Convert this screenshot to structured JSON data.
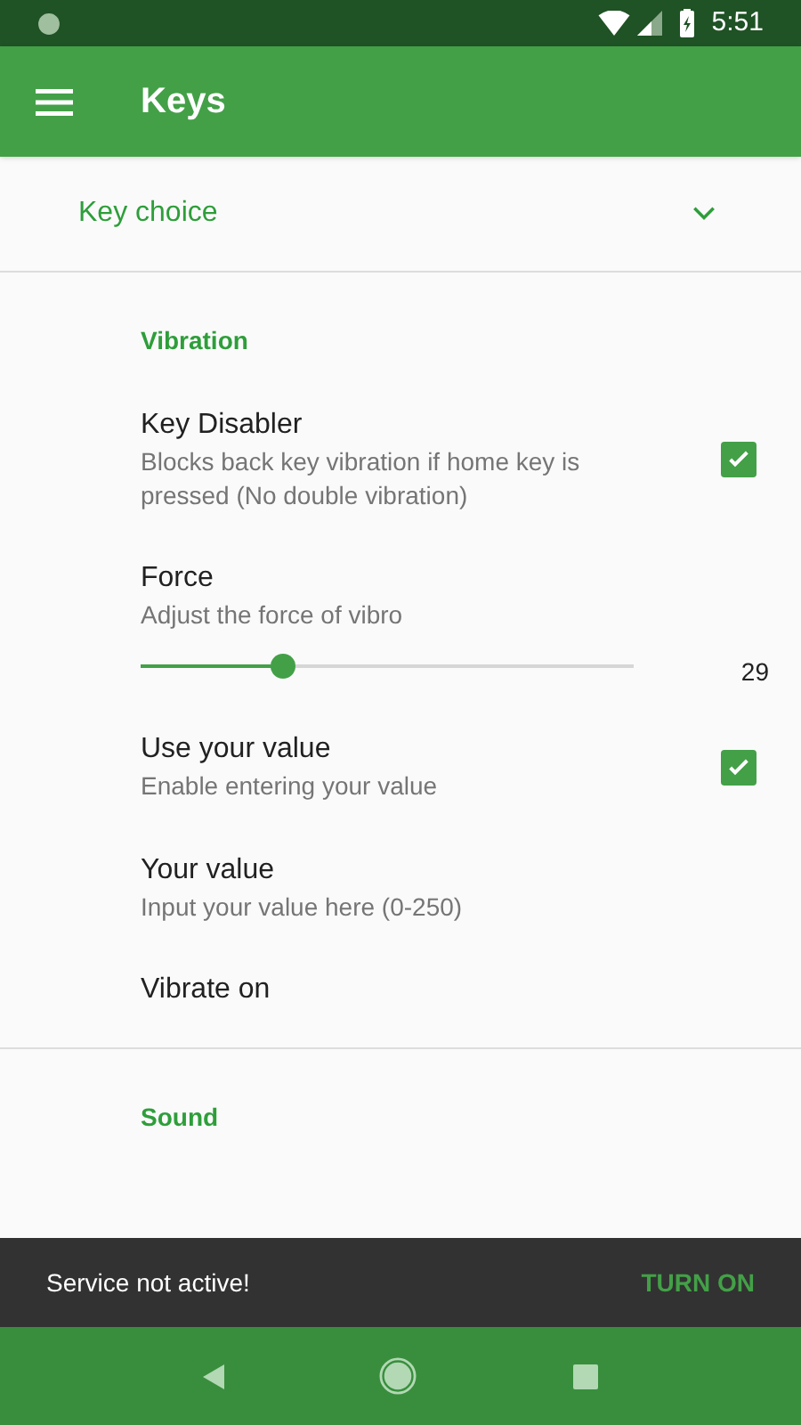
{
  "status_bar": {
    "time": "5:51"
  },
  "app_bar": {
    "title": "Keys"
  },
  "dropdown": {
    "label": "Key choice",
    "expanded": false
  },
  "sections": [
    {
      "header": "Vibration",
      "items": [
        {
          "kind": "checkbox",
          "title": "Key Disabler",
          "summary": "Blocks back key vibration if home key is pressed (No double vibration)",
          "checked": true
        },
        {
          "kind": "slider",
          "title": "Force",
          "summary": "Adjust the force of vibro",
          "level": 0.29,
          "reading": "29"
        },
        {
          "kind": "checkbox",
          "title": "Use your value",
          "summary": "Enable entering your value",
          "checked": true
        },
        {
          "kind": "plain",
          "title": "Your value",
          "summary": "Input your value here (0-250)"
        },
        {
          "kind": "plain",
          "title": "Vibrate on"
        }
      ]
    },
    {
      "header": "Sound"
    }
  ],
  "snackbar": {
    "message": "Service not active!",
    "action": "TURN ON"
  }
}
